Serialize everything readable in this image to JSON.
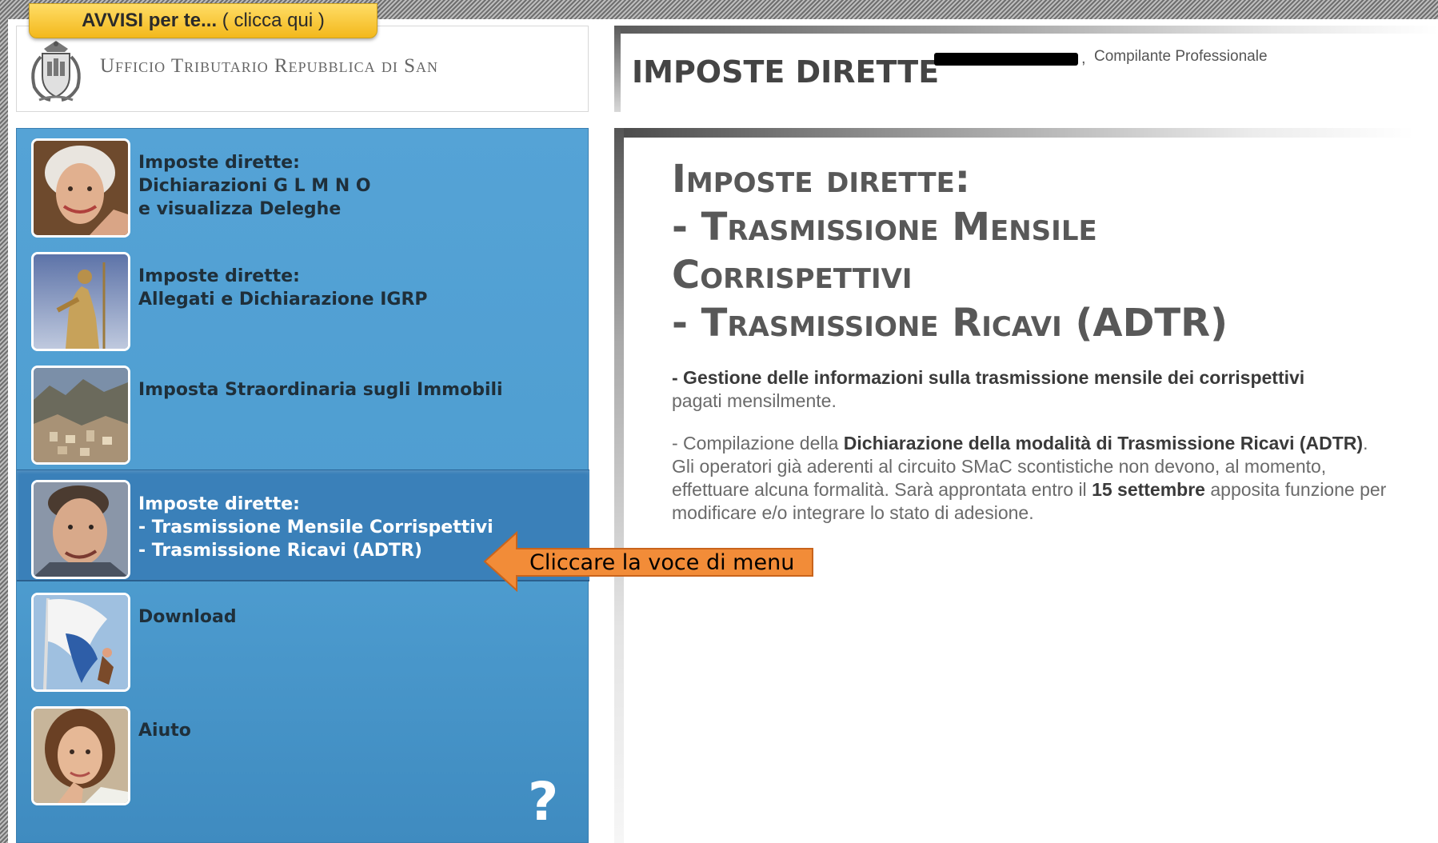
{
  "avvisi": {
    "bold": "AVVISI per te...",
    "rest": " ( clicca qui )"
  },
  "logo": {
    "text": "Ufficio Tributario Repubblica di San"
  },
  "header": {
    "title": "IMPOSTE DIRETTE",
    "role": "Compilante Professionale"
  },
  "menu": {
    "items": [
      {
        "lines": [
          "Imposte dirette:",
          "Dichiarazioni G L M N O",
          "e visualizza Deleghe"
        ]
      },
      {
        "lines": [
          "Imposte dirette:",
          "Allegati e Dichiarazione IGRP"
        ]
      },
      {
        "lines": [
          "Imposta Straordinaria sugli Immobili"
        ]
      },
      {
        "lines": [
          "Imposte dirette:",
          "- Trasmissione Mensile Corrispettivi",
          "- Trasmissione Ricavi (ADTR)"
        ]
      },
      {
        "lines": [
          "Download"
        ]
      },
      {
        "lines": [
          "Aiuto"
        ]
      }
    ],
    "help_mark": "?"
  },
  "content": {
    "title_lines": [
      "Imposte dirette:",
      "- Trasmissione Mensile",
      "Corrispettivi",
      "- Trasmissione Ricavi (ADTR)"
    ],
    "p1_bold": "- Gestione delle informazioni sulla trasmissione mensile dei corrispettivi",
    "p1_rest": "pagati mensilmente.",
    "p2_pre": "- Compilazione della ",
    "p2_bold": "Dichiarazione della modalità di Trasmissione Ricavi (ADTR)",
    "p2_post": ".",
    "p3_pre": "Gli operatori già aderenti al circuito SMaC scontistiche non devono, al momento, effettuare alcuna formalità. Sarà approntata entro il ",
    "p3_bold": "15 settembre",
    "p3_post": " apposita funzione per modificare e/o integrare lo stato di adesione."
  },
  "callout": {
    "text": "Cliccare la voce di menu"
  },
  "colors": {
    "sidebar": "#4e9dd0",
    "active_item": "#3a80b9",
    "callout": "#f08a35",
    "avvisi": "#f5c232"
  }
}
